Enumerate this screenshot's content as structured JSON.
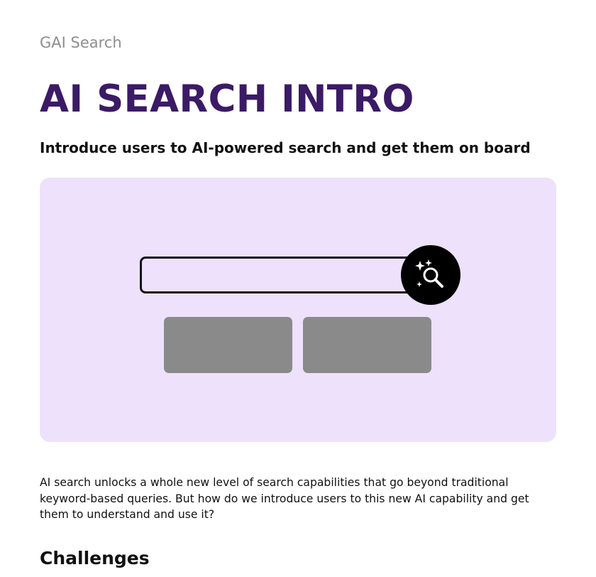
{
  "header": {
    "eyebrow": "GAI Search",
    "title": "AI SEARCH INTRO",
    "subtitle": "Introduce users to AI-powered search and get them on board"
  },
  "hero": {
    "background_color": "#ede1fc",
    "search_input": {
      "value": "",
      "placeholder": ""
    },
    "search_button": {
      "icon": "ai-sparkle-search-icon"
    },
    "placeholder_buttons": [
      {
        "label": ""
      },
      {
        "label": ""
      }
    ]
  },
  "content": {
    "intro_paragraph": "AI search unlocks a whole new level of search capabilities that go beyond traditional keyword-based queries. But how do we introduce users to this new AI capability and get them to understand and use it?",
    "section_heading": "Challenges"
  },
  "colors": {
    "title": "#3b1a66",
    "eyebrow": "#8f8f8f",
    "placeholder_button": "#8a8a8a"
  }
}
